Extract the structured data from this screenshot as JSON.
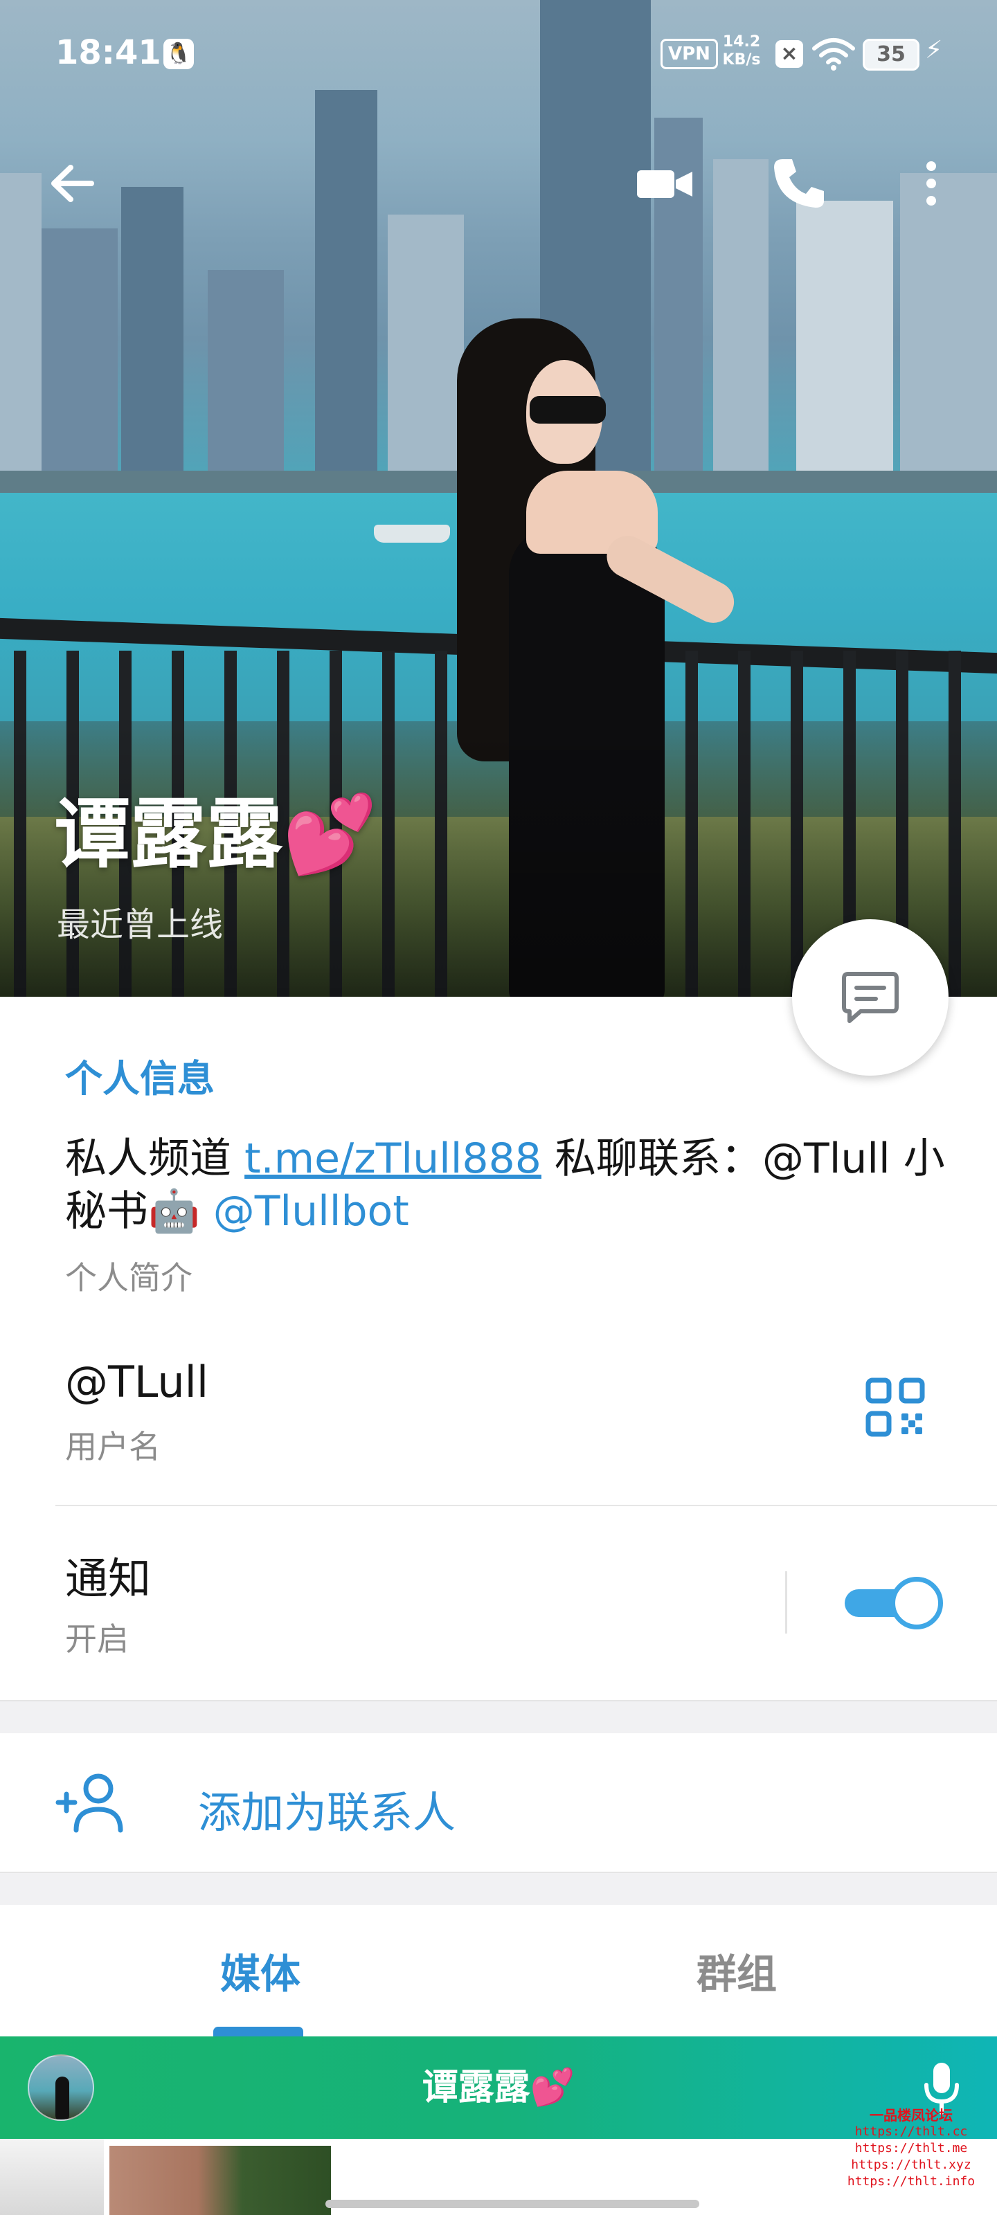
{
  "status_bar": {
    "time": "18:41",
    "qq_icon": "qq-penguin-icon",
    "vpn": "VPN",
    "speed_value": "14.2",
    "speed_unit": "KB/s",
    "battery": "35"
  },
  "top_bar": {
    "back_icon": "arrow-left-icon",
    "video_icon": "video-camera-icon",
    "call_icon": "phone-icon",
    "more_icon": "more-vertical-icon"
  },
  "profile": {
    "name": "谭露露💕",
    "status": "最近曾上线"
  },
  "info": {
    "section_title": "个人信息",
    "bio_prefix": "私人频道 ",
    "bio_link": "t.me/zTlull888",
    "bio_middle": " 私聊联系：@Tlull 小秘书🤖 ",
    "bio_mention": "@Tlullbot",
    "bio_label": "个人简介",
    "username": "@TLull",
    "username_label": "用户名",
    "notify_title": "通知",
    "notify_status": "开启",
    "notify_enabled": true
  },
  "actions": {
    "add_contact": "添加为联系人"
  },
  "tabs": [
    {
      "label": "媒体",
      "active": true
    },
    {
      "label": "群组",
      "active": false
    }
  ],
  "mini_player": {
    "name": "谭露露💕"
  },
  "watermark": {
    "title": "一品楼凤论坛",
    "lines": [
      "https://thlt.cc",
      "https://thlt.me",
      "https://thlt.xyz",
      "https://thlt.info"
    ]
  },
  "colors": {
    "accent": "#2e8fd5",
    "toggle": "#3fa7e6",
    "mini_bar_start": "#19b46d",
    "mini_bar_end": "#0fb5b6",
    "watermark": "#e0141e"
  }
}
